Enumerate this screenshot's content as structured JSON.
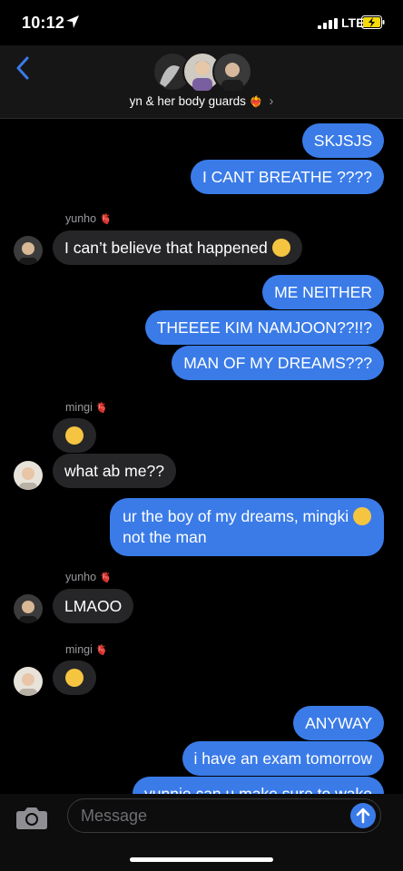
{
  "status_bar": {
    "time": "10:12",
    "network": "LTE"
  },
  "header": {
    "group_name": "yn & her body guards",
    "heart": "❤️‍🔥"
  },
  "messages": [
    {
      "dir": "out",
      "text": "SKJSJS"
    },
    {
      "dir": "out",
      "text": "I CANT BREATHE ????"
    },
    {
      "dir": "in",
      "sender": "yunho",
      "text": "I can’t believe that happened"
    },
    {
      "dir": "out",
      "text": "ME NEITHER"
    },
    {
      "dir": "out",
      "text": "THEEEE KIM NAMJOON??!!?"
    },
    {
      "dir": "out",
      "text": "MAN OF MY DREAMS???"
    },
    {
      "dir": "in",
      "sender": "mingi",
      "text": "🥺"
    },
    {
      "dir": "in",
      "sender": "mingi",
      "text": "what ab me??"
    },
    {
      "dir": "out",
      "text_line1": "ur the boy of my dreams, mingki",
      "text_line2": "not the man"
    },
    {
      "dir": "in",
      "sender": "yunho",
      "text": "LMAOO"
    },
    {
      "dir": "in",
      "sender": "mingi",
      "text": "😧"
    },
    {
      "dir": "out",
      "text": "ANYWAY"
    },
    {
      "dir": "out",
      "text": "i have an exam tomorrow"
    },
    {
      "dir": "out",
      "text": "yunnie can u make sure to wake"
    }
  ],
  "senders": {
    "yunho": "yunho",
    "mingi": "mingi"
  },
  "input": {
    "placeholder": "Message"
  },
  "colors": {
    "outgoing": "#3a7be8",
    "incoming": "#262628",
    "background": "#000000"
  }
}
